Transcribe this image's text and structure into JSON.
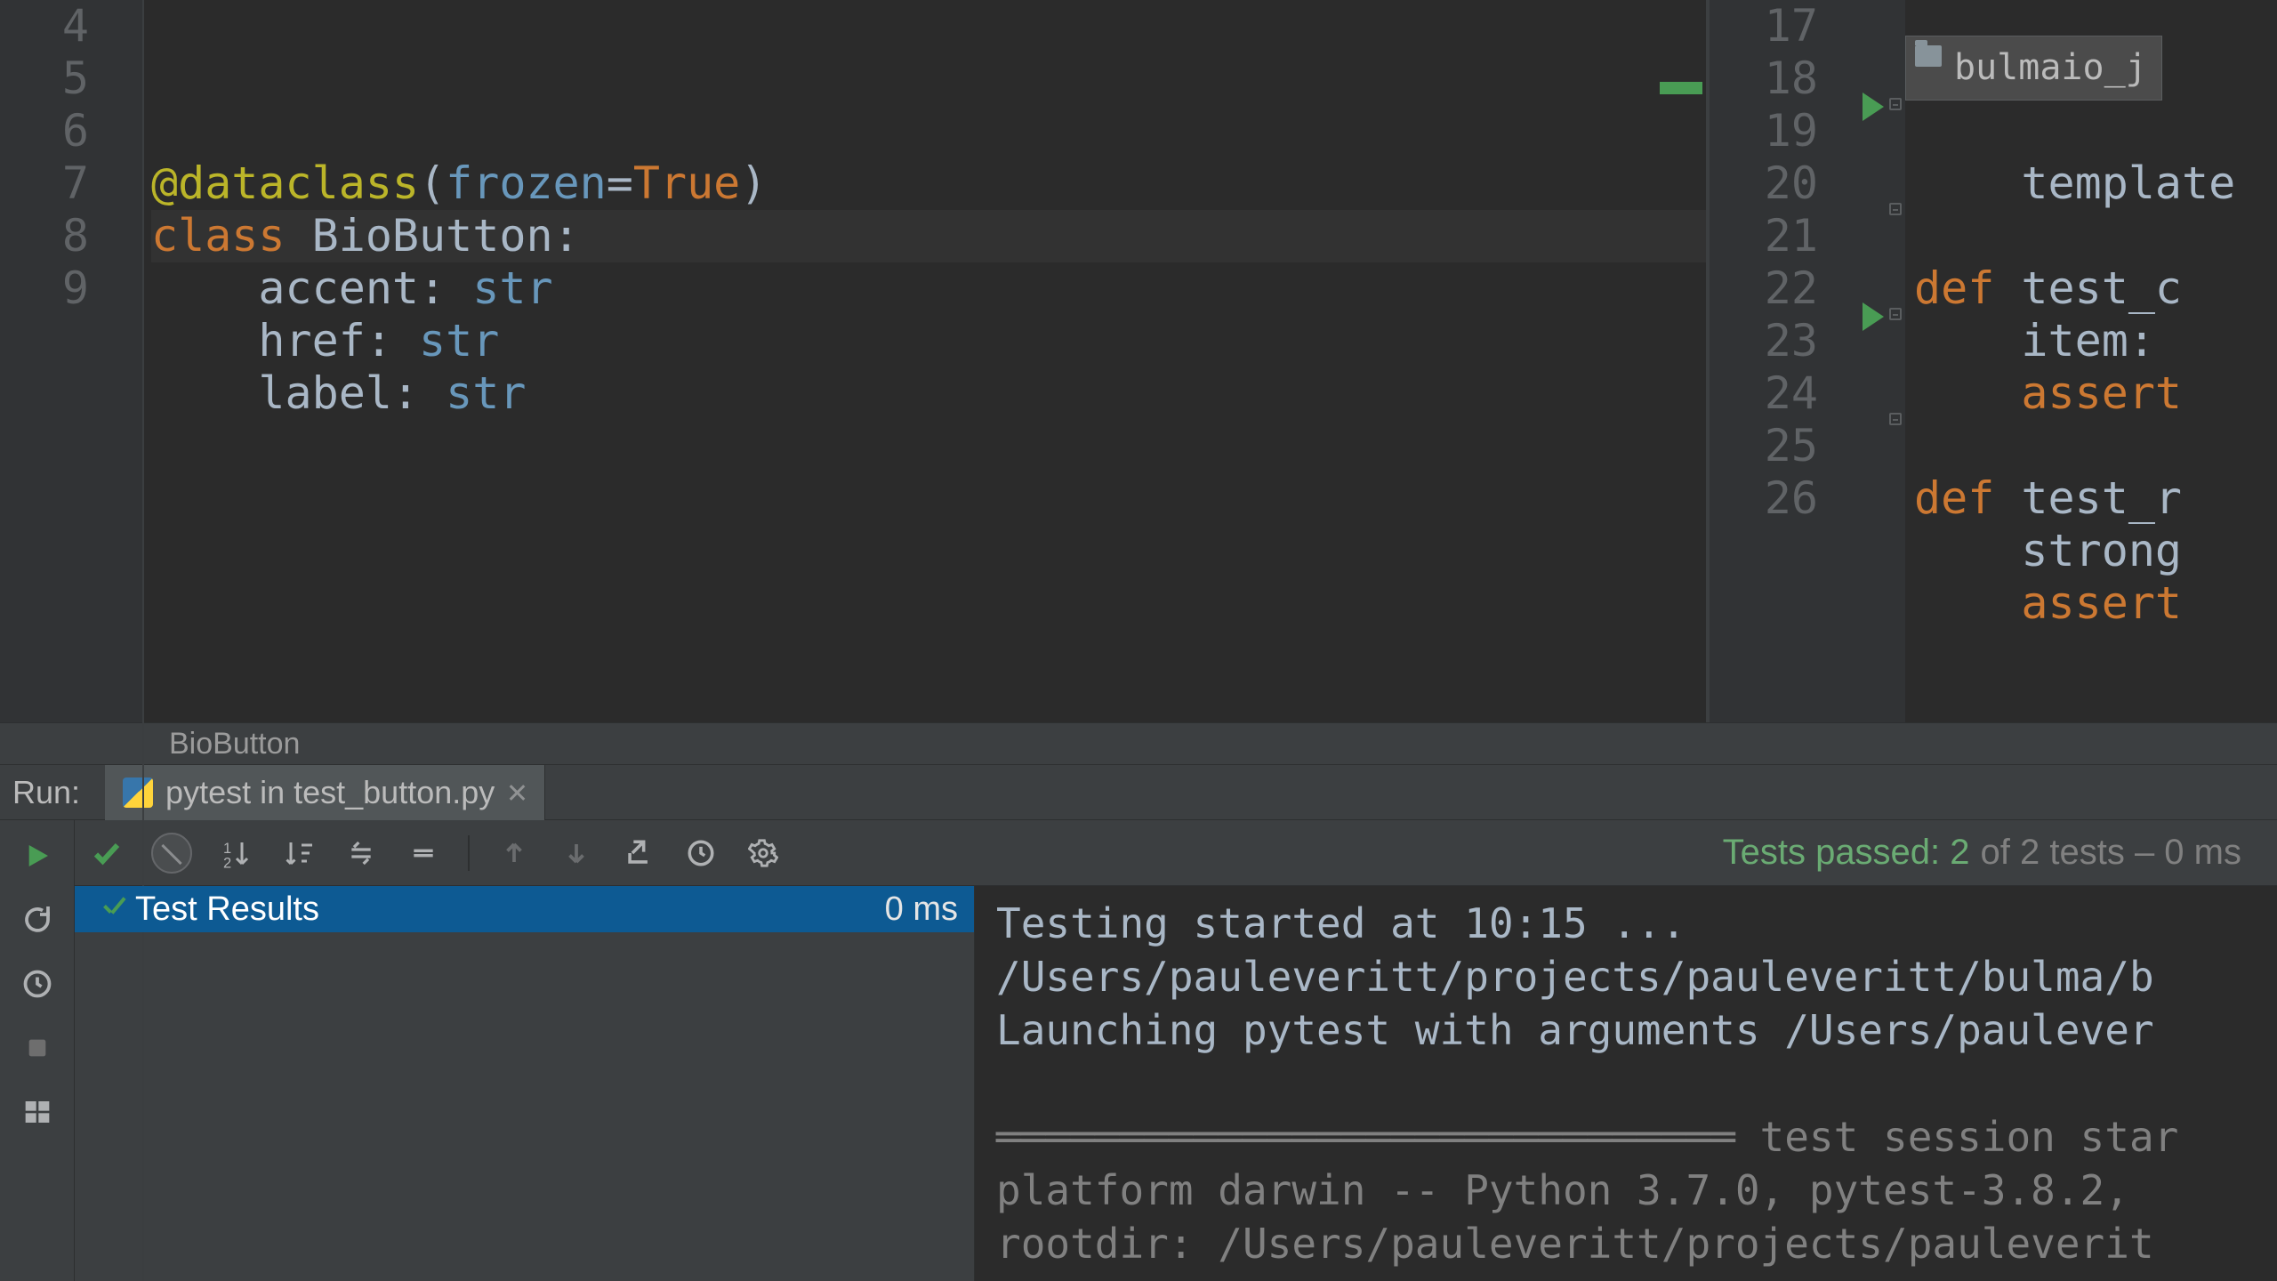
{
  "left_editor": {
    "lines": {
      "4": {
        "segments": [
          {
            "t": "@dataclass",
            "c": "kw-decor"
          },
          {
            "t": "(",
            "c": "plain"
          },
          {
            "t": "frozen",
            "c": "kw-blue"
          },
          {
            "t": "=",
            "c": "plain"
          },
          {
            "t": "True",
            "c": "kw-orange"
          },
          {
            "t": ")",
            "c": "plain"
          }
        ]
      },
      "5": {
        "segments": [
          {
            "t": "class ",
            "c": "kw-orange"
          },
          {
            "t": "BioButton",
            "c": "cls-name"
          },
          {
            "t": ":",
            "c": "plain"
          }
        ],
        "caret": true
      },
      "6": {
        "segments": [
          {
            "t": "    accent: ",
            "c": "plain"
          },
          {
            "t": "str",
            "c": "kw-blue"
          }
        ]
      },
      "7": {
        "segments": [
          {
            "t": "    href: ",
            "c": "plain"
          },
          {
            "t": "str",
            "c": "kw-blue"
          }
        ]
      },
      "8": {
        "segments": [
          {
            "t": "    label: ",
            "c": "plain"
          },
          {
            "t": "str",
            "c": "kw-blue"
          }
        ]
      },
      "9": {
        "segments": []
      }
    },
    "line_numbers": [
      "4",
      "5",
      "6",
      "7",
      "8",
      "9"
    ]
  },
  "right_editor": {
    "line_numbers": [
      "17",
      "18",
      "19",
      "20",
      "21",
      "22",
      "23",
      "24",
      "25",
      "26"
    ],
    "lines": {
      "17": {
        "segments": [
          {
            "t": "    template ",
            "c": "plain"
          }
        ]
      },
      "18": {
        "segments": []
      },
      "19": {
        "segments": [
          {
            "t": "def ",
            "c": "kw-orange"
          },
          {
            "t": "test_c",
            "c": "plain"
          }
        ]
      },
      "20": {
        "segments": [
          {
            "t": "    item: ",
            "c": "plain"
          }
        ]
      },
      "21": {
        "segments": [
          {
            "t": "    ",
            "c": "plain"
          },
          {
            "t": "assert",
            "c": "kw-orange"
          }
        ]
      },
      "22": {
        "segments": []
      },
      "23": {
        "segments": [
          {
            "t": "def ",
            "c": "kw-orange"
          },
          {
            "t": "test_r",
            "c": "plain"
          }
        ]
      },
      "24": {
        "segments": [
          {
            "t": "    strong",
            "c": "plain"
          }
        ]
      },
      "25": {
        "segments": [
          {
            "t": "    ",
            "c": "plain"
          },
          {
            "t": "assert",
            "c": "kw-orange"
          }
        ]
      },
      "26": {
        "segments": []
      }
    },
    "folder_chip": "bulmaio_j"
  },
  "breadcrumb": {
    "item": "BioButton"
  },
  "run": {
    "title": "Run:",
    "tab": "pytest in test_button.py",
    "summary_pass": "Tests passed: 2",
    "summary_rest": " of 2 tests – 0 ms",
    "tree": {
      "label": "Test Results",
      "time": "0 ms"
    },
    "console_lines": [
      "Testing started at 10:15 ...",
      "/Users/pauleveritt/projects/pauleveritt/bulma/b",
      "Launching pytest with arguments /Users/paulever",
      "",
      "══════════════════════════════ test session star",
      "platform darwin -- Python 3.7.0, pytest-3.8.2, ",
      "rootdir: /Users/pauleveritt/projects/pauleverit"
    ]
  }
}
